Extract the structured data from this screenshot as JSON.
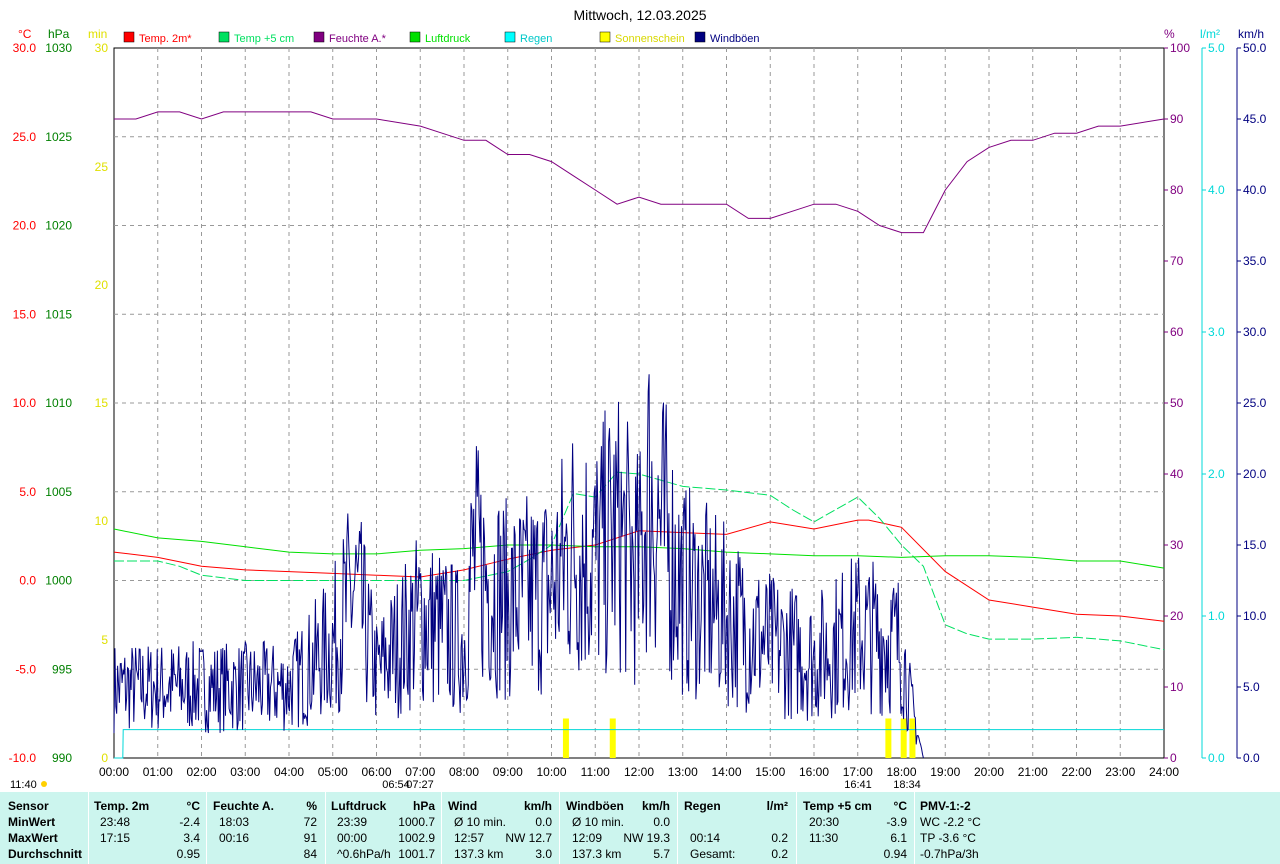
{
  "chart_data": {
    "type": "line",
    "title": "Mittwoch, 12.03.2025",
    "x_ticks": [
      "00:00",
      "01:00",
      "02:00",
      "03:00",
      "04:00",
      "05:00",
      "06:00",
      "07:00",
      "08:00",
      "09:00",
      "10:00",
      "11:00",
      "12:00",
      "13:00",
      "14:00",
      "15:00",
      "16:00",
      "17:00",
      "18:00",
      "19:00",
      "20:00",
      "21:00",
      "22:00",
      "23:00",
      "24:00"
    ],
    "axes": {
      "temp": {
        "unit": "°C",
        "range": [
          -10,
          30
        ],
        "ticks": [
          "30.0",
          "25.0",
          "20.0",
          "15.0",
          "10.0",
          "5.0",
          "0.0",
          "-5.0",
          "-10.0"
        ],
        "color": "#ff0000"
      },
      "pressure": {
        "unit": "hPa",
        "range": [
          990,
          1030
        ],
        "ticks": [
          "1030",
          "1025",
          "1020",
          "1015",
          "1010",
          "1005",
          "1000",
          "995",
          "990"
        ],
        "color": "#008000"
      },
      "sunshine": {
        "unit": "min",
        "range": [
          0,
          30
        ],
        "ticks": [
          "30",
          "25",
          "20",
          "15",
          "10",
          "5",
          "0"
        ],
        "color": "#ffff00"
      },
      "humidity": {
        "unit": "%",
        "range": [
          0,
          100
        ],
        "ticks": [
          "100",
          "90",
          "80",
          "70",
          "60",
          "50",
          "40",
          "30",
          "20",
          "10",
          "0"
        ],
        "color": "#800080"
      },
      "rain": {
        "unit": "l/m²",
        "range": [
          0,
          5
        ],
        "ticks": [
          "5.0",
          "4.0",
          "3.0",
          "2.0",
          "1.0",
          "0.0"
        ],
        "color": "#00e0e0"
      },
      "wind": {
        "unit": "km/h",
        "range": [
          0,
          50
        ],
        "ticks": [
          "50.0",
          "45.0",
          "40.0",
          "35.0",
          "30.0",
          "25.0",
          "20.0",
          "15.0",
          "10.0",
          "5.0",
          "0.0"
        ],
        "color": "#000080"
      }
    },
    "legend": [
      {
        "label": "Temp. 2m*",
        "color": "#ff0000"
      },
      {
        "label": "Temp +5 cm",
        "color": "#00e060"
      },
      {
        "label": "Feuchte A.*",
        "color": "#800080"
      },
      {
        "label": "Luftdruck",
        "color": "#00e000"
      },
      {
        "label": "Regen",
        "color": "#00ffff"
      },
      {
        "label": "Sonnenschein",
        "color": "#ffff00"
      },
      {
        "label": "Windböen",
        "color": "#000080"
      }
    ],
    "series": [
      {
        "name": "Temp. 2m*",
        "axis": "temp",
        "x": [
          0,
          1,
          2,
          3,
          4,
          5,
          6,
          7,
          8,
          9,
          10,
          11,
          12,
          13,
          14,
          15,
          16,
          17,
          17.25,
          18,
          19,
          20,
          21,
          22,
          23,
          24
        ],
        "y": [
          1.6,
          1.3,
          0.8,
          0.6,
          0.5,
          0.4,
          0.3,
          0.2,
          0.6,
          1.2,
          1.7,
          2.0,
          2.8,
          2.7,
          2.6,
          3.3,
          2.9,
          3.4,
          3.4,
          3.0,
          0.5,
          -1.1,
          -1.5,
          -1.9,
          -2.0,
          -2.3
        ]
      },
      {
        "name": "Temp +5 cm",
        "axis": "temp",
        "x": [
          0,
          1,
          1.5,
          2,
          3,
          4,
          5,
          6,
          7,
          8,
          9,
          9.5,
          10,
          10.5,
          11,
          11.5,
          12,
          13,
          14,
          15,
          15.5,
          16,
          17,
          17.5,
          18,
          18.5,
          19,
          19.5,
          20,
          21,
          22,
          23,
          24
        ],
        "y": [
          1.1,
          1.1,
          0.8,
          0.3,
          0.0,
          0.0,
          0.0,
          0.0,
          0.0,
          0.0,
          0.5,
          1.2,
          2.0,
          4.9,
          4.7,
          6.1,
          6.0,
          5.3,
          5.1,
          4.8,
          4.0,
          3.3,
          4.7,
          3.5,
          2.0,
          0.8,
          -2.5,
          -3.0,
          -3.3,
          -3.3,
          -3.2,
          -3.4,
          -3.9
        ]
      },
      {
        "name": "Feuchte A.*",
        "axis": "humidity",
        "x": [
          0,
          0.5,
          1,
          1.5,
          2,
          2.5,
          3,
          4,
          4.5,
          5,
          6,
          7,
          8,
          8.5,
          9,
          9.5,
          10,
          10.5,
          11,
          11.5,
          12,
          12.5,
          13,
          13.5,
          14,
          14.5,
          15,
          15.5,
          16,
          16.5,
          17,
          17.5,
          18,
          18.5,
          19,
          19.5,
          20,
          20.5,
          21,
          21.5,
          22,
          22.5,
          23,
          24
        ],
        "y": [
          90,
          90,
          91,
          91,
          90,
          91,
          91,
          91,
          91,
          90,
          90,
          89,
          87,
          87,
          85,
          85,
          84,
          82,
          80,
          78,
          79,
          78,
          78,
          78,
          78,
          76,
          76,
          77,
          78,
          78,
          77,
          75,
          74,
          74,
          80,
          84,
          86,
          87,
          87,
          88,
          88,
          89,
          89,
          90
        ]
      },
      {
        "name": "Luftdruck",
        "axis": "pressure",
        "x": [
          0,
          1,
          2,
          3,
          4,
          5,
          6,
          7,
          8,
          9,
          10,
          11,
          12,
          13,
          14,
          15,
          16,
          17,
          18,
          19,
          20,
          21,
          22,
          23,
          24
        ],
        "y": [
          1002.9,
          1002.4,
          1002.2,
          1001.9,
          1001.6,
          1001.5,
          1001.5,
          1001.7,
          1001.8,
          1002.0,
          1002.0,
          1001.9,
          1001.9,
          1001.8,
          1001.6,
          1001.5,
          1001.4,
          1001.4,
          1001.3,
          1001.4,
          1001.4,
          1001.3,
          1001.1,
          1001.1,
          1000.7
        ]
      },
      {
        "name": "Regen",
        "axis": "rain",
        "x": [
          0,
          0.2,
          0.21,
          24
        ],
        "y": [
          0,
          0,
          0.2,
          0.2
        ]
      },
      {
        "name": "Windböen",
        "axis": "wind",
        "x": [
          0,
          1,
          2,
          3,
          4,
          5,
          5.5,
          6,
          7,
          8,
          8.2,
          9,
          10,
          10.5,
          11,
          11.5,
          12,
          12.2,
          13,
          14,
          15,
          16,
          17,
          18,
          18.2,
          18.5
        ],
        "y": [
          5,
          5,
          5,
          5,
          5,
          8,
          12,
          6,
          10,
          8,
          14,
          11,
          12,
          15,
          14,
          16,
          13,
          19,
          12,
          10,
          8,
          7,
          9,
          8,
          4,
          0
        ]
      }
    ],
    "sunshine_bars": [
      {
        "x": 10.33,
        "y": 5
      },
      {
        "x": 11.4,
        "y": 5
      },
      {
        "x": 17.7,
        "y": 5
      },
      {
        "x": 18.05,
        "y": 5
      },
      {
        "x": 18.25,
        "y": 5
      }
    ],
    "sun_markers": {
      "sunrise": "06:54",
      "sunrise2": "07:27",
      "sunset1": "16:41",
      "sunset2": "18:34"
    },
    "left_time": "11:40"
  },
  "summary": {
    "sensor": {
      "header": "Sensor",
      "rows": [
        "MinWert",
        "MaxWert",
        "Durchschnitt"
      ]
    },
    "temp2m": {
      "header": "Temp. 2m",
      "unit": "°C",
      "rows": [
        [
          "23:48",
          "-2.4"
        ],
        [
          "17:15",
          "3.4"
        ],
        [
          "",
          "0.95"
        ]
      ]
    },
    "feuchte": {
      "header": "Feuchte A.",
      "unit": "%",
      "rows": [
        [
          "18:03",
          "72"
        ],
        [
          "00:16",
          "91"
        ],
        [
          "",
          "84"
        ]
      ]
    },
    "luftdruck": {
      "header": "Luftdruck",
      "unit": "hPa",
      "rows": [
        [
          "23:39",
          "1000.7"
        ],
        [
          "00:00",
          "1002.9"
        ],
        [
          "^0.6hPa/h",
          "1001.7"
        ]
      ]
    },
    "wind": {
      "header": "Wind",
      "unit": "km/h",
      "rows": [
        [
          "Ø 10 min.",
          "0.0"
        ],
        [
          "12:57",
          "NW 12.7"
        ],
        [
          "137.3 km",
          "3.0"
        ]
      ]
    },
    "windboeen": {
      "header": "Windböen",
      "unit": "km/h",
      "rows": [
        [
          "Ø 10 min.",
          "0.0"
        ],
        [
          "12:09",
          "NW 19.3"
        ],
        [
          "137.3 km",
          "5.7"
        ]
      ]
    },
    "regen": {
      "header": "Regen",
      "unit": "l/m²",
      "rows": [
        [
          "",
          ""
        ],
        [
          "00:14",
          "0.2"
        ],
        [
          "Gesamt:",
          "0.2"
        ]
      ]
    },
    "temp5cm": {
      "header": "Temp +5 cm",
      "unit": "°C",
      "rows": [
        [
          "20:30",
          "-3.9"
        ],
        [
          "11:30",
          "6.1"
        ],
        [
          "",
          "0.94"
        ]
      ]
    },
    "pmv": {
      "header": "PMV-1:-2",
      "rows": [
        "WC -2.2 °C",
        "TP -3.6 °C",
        "-0.7hPa/3h"
      ]
    }
  }
}
